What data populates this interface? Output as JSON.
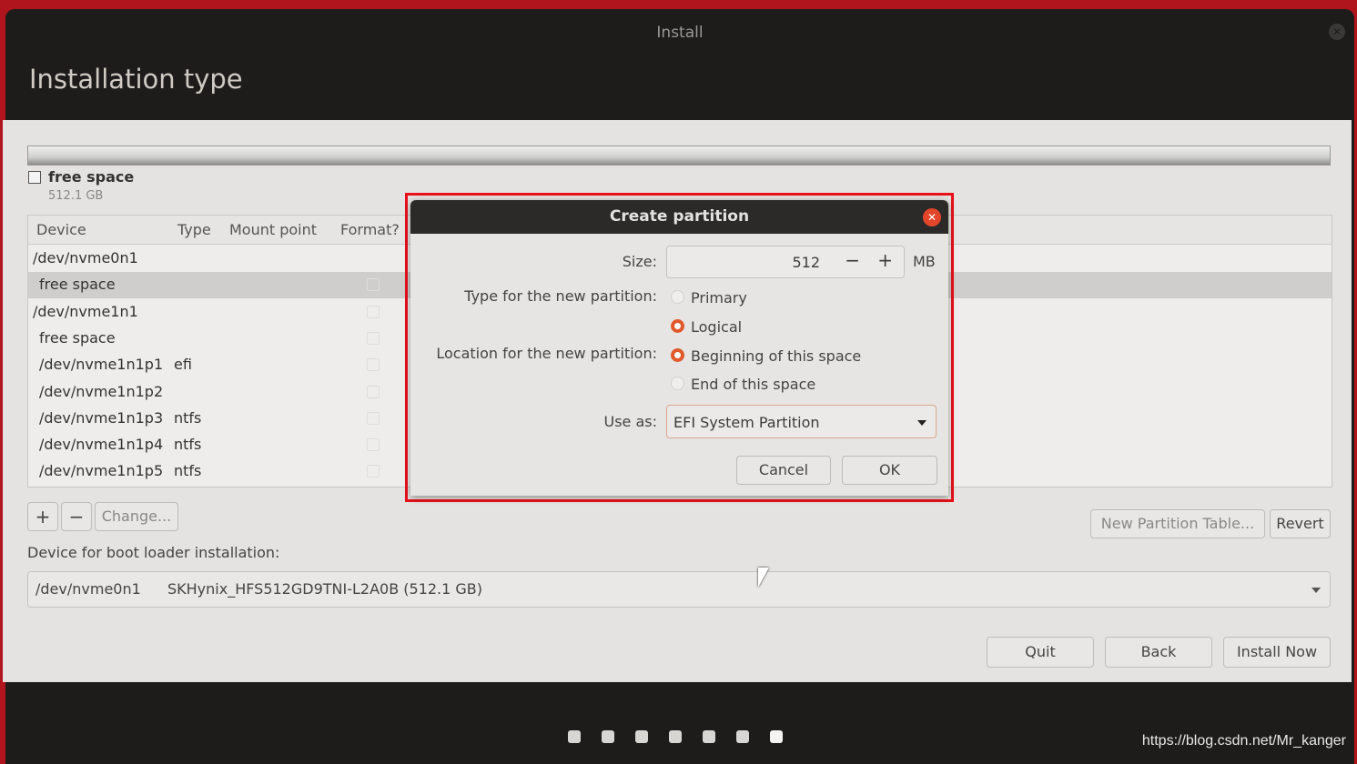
{
  "window": {
    "title": "Install",
    "header": "Installation type"
  },
  "disk": {
    "legend_name": "free space",
    "legend_size": "512.1 GB"
  },
  "table": {
    "columns": [
      "Device",
      "Type",
      "Mount point",
      "Format?"
    ],
    "rows": [
      {
        "device": "/dev/nvme0n1",
        "type": ""
      },
      {
        "device": "free space",
        "type": "",
        "selected": true
      },
      {
        "device": "/dev/nvme1n1",
        "type": ""
      },
      {
        "device": "free space",
        "type": ""
      },
      {
        "device": "/dev/nvme1n1p1",
        "type": "efi"
      },
      {
        "device": "/dev/nvme1n1p2",
        "type": ""
      },
      {
        "device": "/dev/nvme1n1p3",
        "type": "ntfs"
      },
      {
        "device": "/dev/nvme1n1p4",
        "type": "ntfs"
      },
      {
        "device": "/dev/nvme1n1p5",
        "type": "ntfs"
      }
    ]
  },
  "toolbar": {
    "add": "+",
    "remove": "−",
    "change": "Change...",
    "new_table": "New Partition Table...",
    "revert": "Revert"
  },
  "bootloader": {
    "label": "Device for boot loader installation:",
    "device": "/dev/nvme0n1",
    "model": "SKHynix_HFS512GD9TNI-L2A0B (512.1 GB)"
  },
  "footer": {
    "quit": "Quit",
    "back": "Back",
    "install": "Install Now"
  },
  "progress_dots": {
    "total": 7,
    "current": 7
  },
  "dialog": {
    "title": "Create partition",
    "size_label": "Size:",
    "size_value": "512",
    "size_unit": "MB",
    "minus": "−",
    "plus": "+",
    "type_label": "Type for the new partition:",
    "type_options": [
      "Primary",
      "Logical"
    ],
    "type_selected": "Logical",
    "location_label": "Location for the new partition:",
    "location_options": [
      "Beginning of this space",
      "End of this space"
    ],
    "location_selected": "Beginning of this space",
    "use_as_label": "Use as:",
    "use_as_value": "EFI System Partition",
    "cancel": "Cancel",
    "ok": "OK"
  },
  "accent": "#e05a2b",
  "watermark": "https://blog.csdn.net/Mr_kanger"
}
